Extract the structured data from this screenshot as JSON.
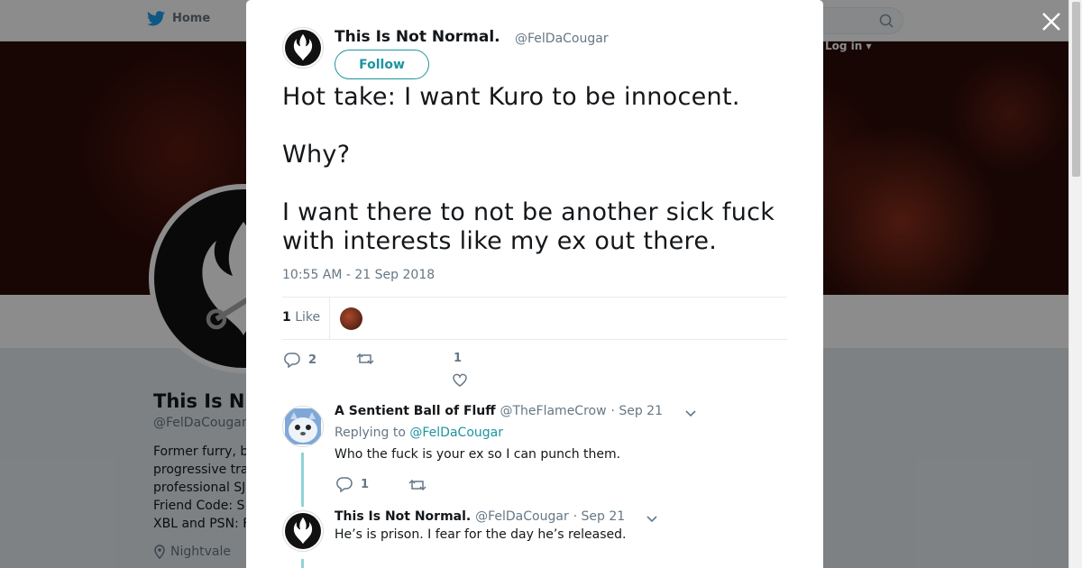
{
  "nav": {
    "home_label": "Home",
    "login_label": "Log in"
  },
  "profile": {
    "name": "This Is N",
    "handle": "@FelDaCougar",
    "bio_lines": [
      "Former furry, b",
      "progressive tra",
      "professional SJ",
      "Friend Code: S",
      "XBL and PSN: F"
    ],
    "location": "Nightvale"
  },
  "tweet": {
    "author_name": "This Is Not Normal.",
    "author_handle": "@FelDaCougar",
    "follow_label": "Follow",
    "text": "Hot take: I want Kuro to be innocent.\n\nWhy?\n\nI want there to not be another sick fuck with interests like my ex out there.",
    "timestamp": "10:55 AM - 21 Sep 2018",
    "likes_count": "1",
    "likes_label": "Like",
    "reply_count": "2",
    "like_action_count": "1"
  },
  "replies": [
    {
      "name": "A Sentient Ball of Fluff",
      "handle": "@TheFlameCrow",
      "date": "· Sep 21",
      "replying_prefix": "Replying to",
      "replying_to": "@FelDaCougar",
      "text": "Who the fuck is your ex so I can punch them.",
      "reply_count": "1"
    },
    {
      "name": "This Is Not Normal.",
      "handle": "@FelDaCougar",
      "date": "· Sep 21",
      "text": "He’s is prison. I fear for the day he’s released."
    }
  ],
  "colors": {
    "accent": "#1b95a0",
    "thread_line": "#8ed3d8",
    "muted": "#657786"
  }
}
